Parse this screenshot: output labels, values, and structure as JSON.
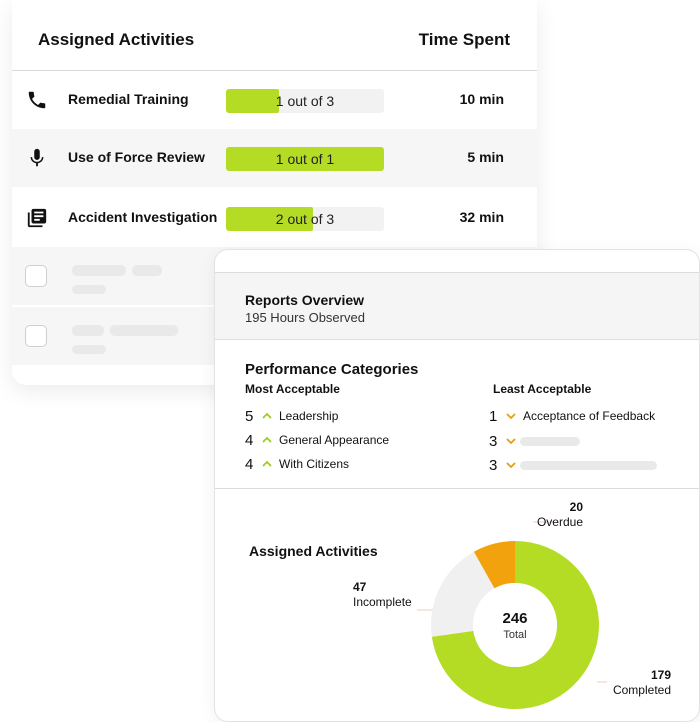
{
  "activities_table": {
    "header": {
      "title": "Assigned Activities",
      "time_label": "Time Spent"
    },
    "rows": [
      {
        "icon": "phone-icon",
        "name": "Remedial Training",
        "progress": "1 out of 3",
        "fraction": 0.333,
        "time": "10 min"
      },
      {
        "icon": "microphone-icon",
        "name": "Use of Force Review",
        "progress": "1 out of 1",
        "fraction": 1.0,
        "time": "5 min"
      },
      {
        "icon": "library-books-icon",
        "name": "Accident Investigation",
        "progress": "2 out of 3",
        "fraction": 0.55,
        "time": "32 min"
      }
    ],
    "accent": "#b5dc25"
  },
  "reports": {
    "title": "Reports Overview",
    "subtitle": "195 Hours Observed",
    "performance": {
      "title": "Performance Categories",
      "most": {
        "label": "Most Acceptable",
        "items": [
          {
            "count": "5",
            "label": "Leadership"
          },
          {
            "count": "4",
            "label": "General Appearance"
          },
          {
            "count": "4",
            "label": "With Citizens"
          }
        ]
      },
      "least": {
        "label": "Least Acceptable",
        "items": [
          {
            "count": "1",
            "label": "Acceptance of Feedback"
          },
          {
            "count": "3",
            "label": ""
          },
          {
            "count": "3",
            "label": ""
          }
        ]
      },
      "up_color": "#9ccc1d",
      "down_color": "#e89e10"
    },
    "assigned": {
      "title": "Assigned Activities",
      "total": "246",
      "total_label": "Total",
      "segments": [
        {
          "value": 179,
          "value_text": "179",
          "label": "Completed",
          "color": "#b5dc25"
        },
        {
          "value": 47,
          "value_text": "47",
          "label": "Incomplete",
          "color": "#f0f0f0"
        },
        {
          "value": 20,
          "value_text": "20",
          "label": "Overdue",
          "color": "#f2a20c"
        }
      ]
    }
  },
  "chart_data": {
    "type": "pie",
    "categories": [
      "Completed",
      "Incomplete",
      "Overdue"
    ],
    "values": [
      179,
      47,
      20
    ],
    "title": "Assigned Activities",
    "total": 246
  }
}
